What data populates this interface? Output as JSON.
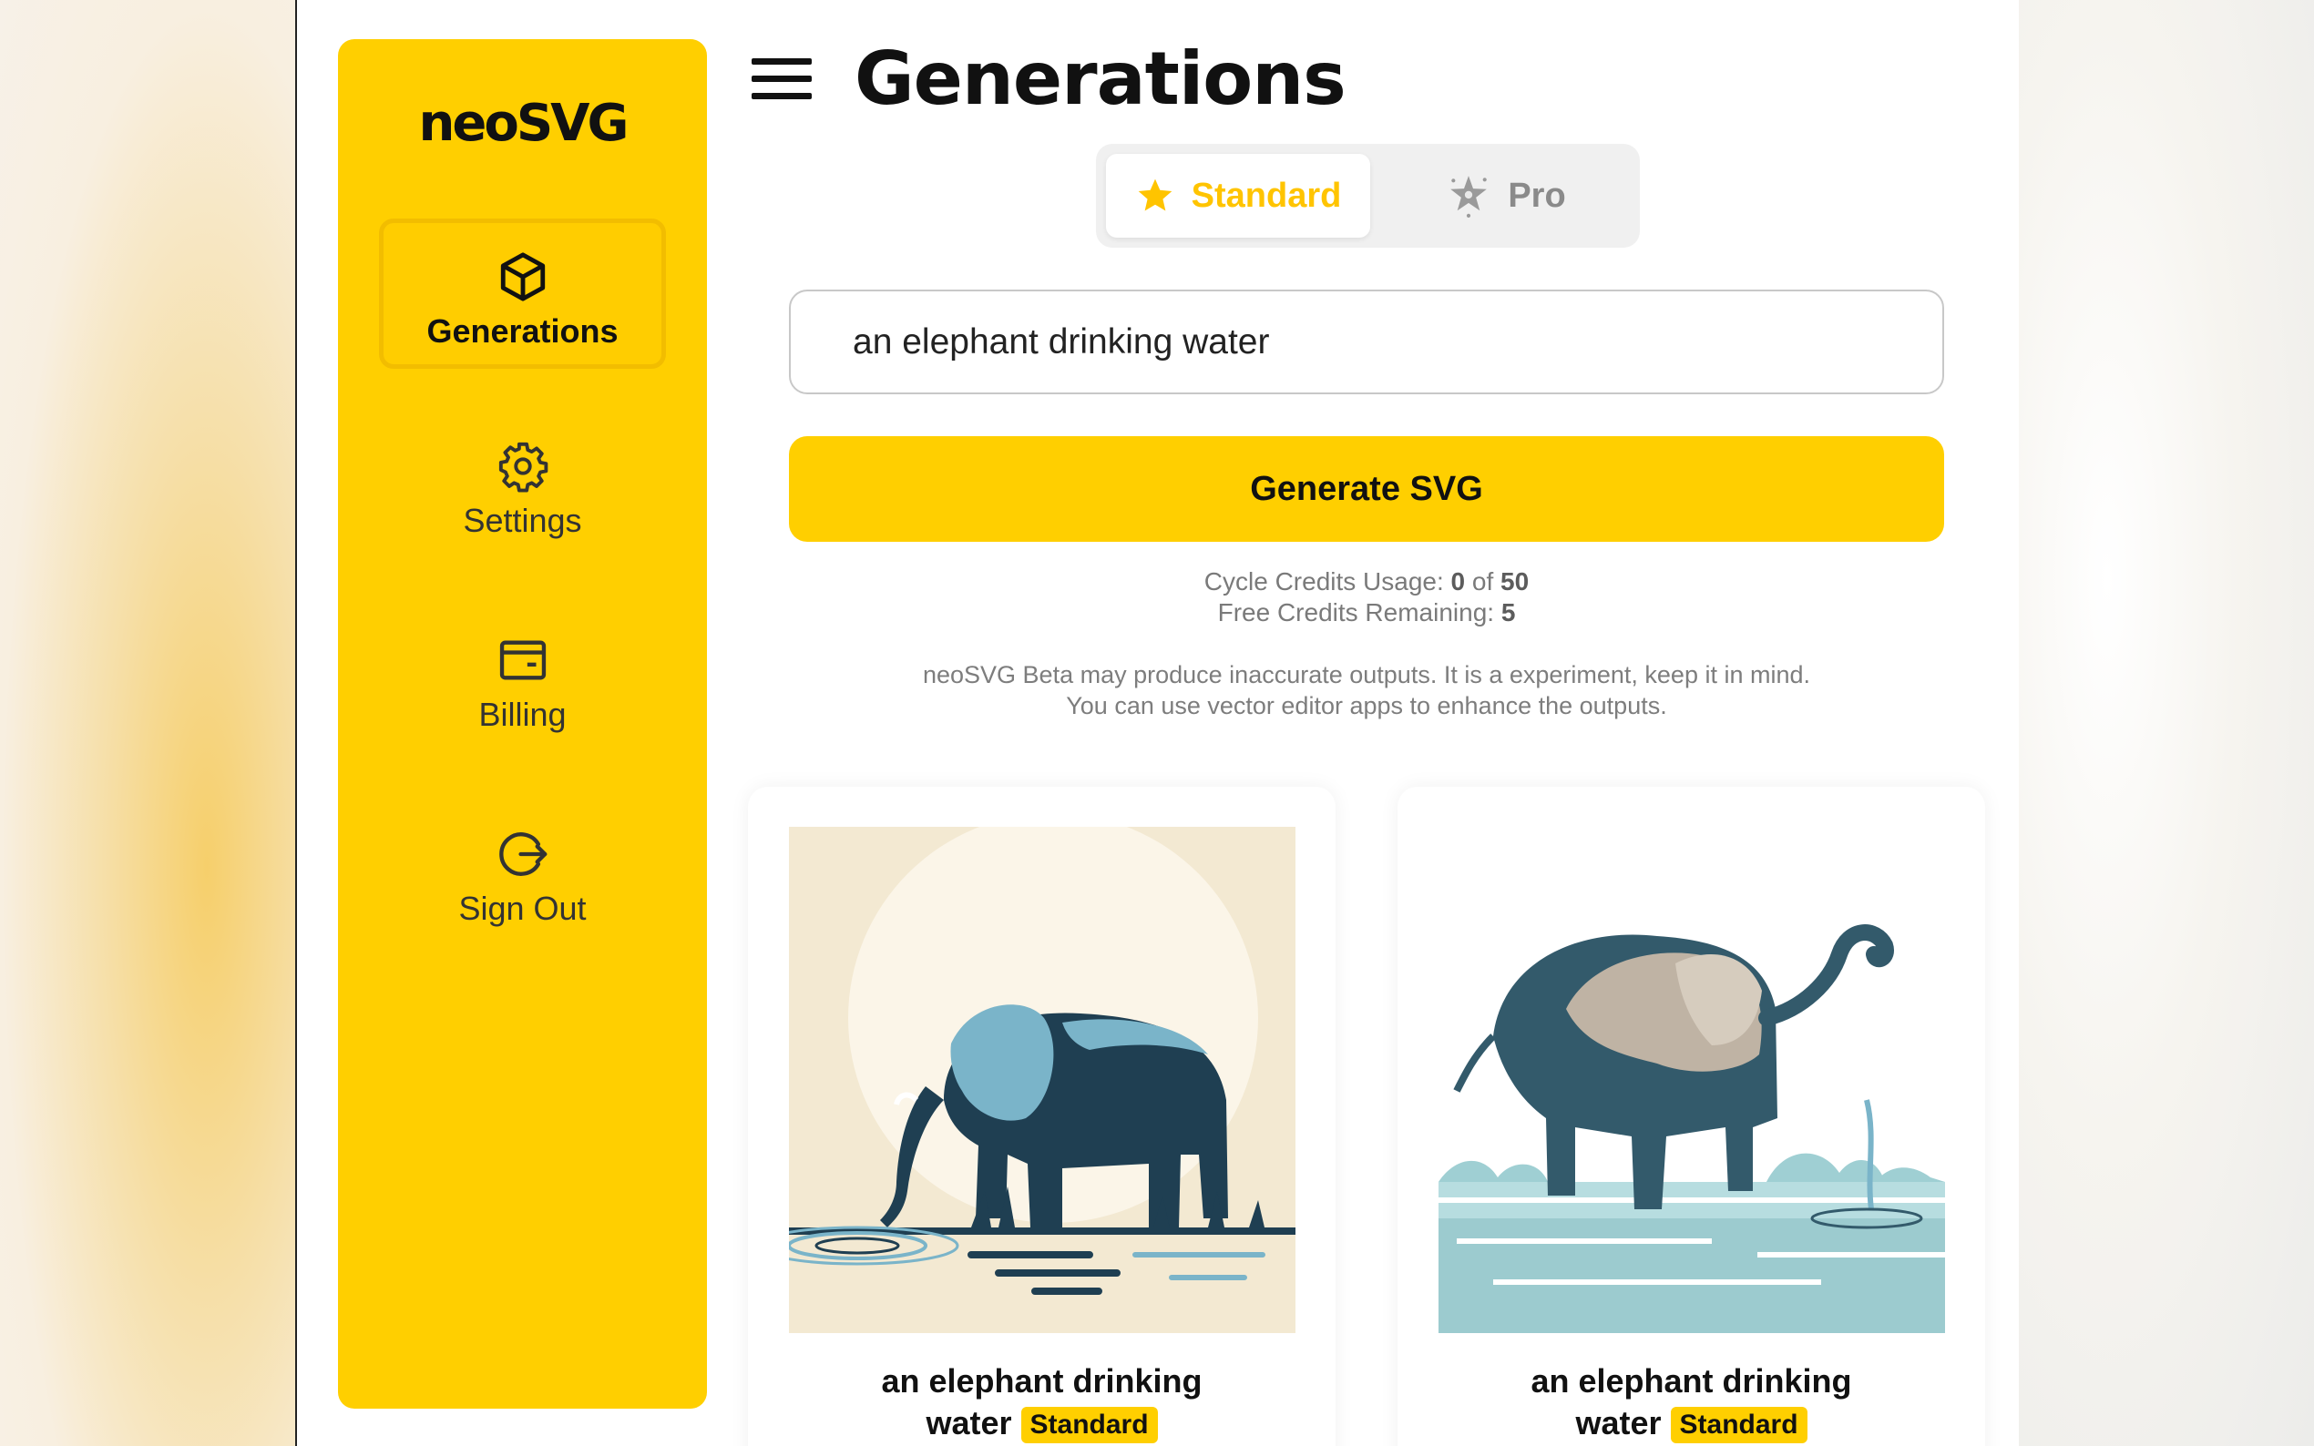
{
  "app": {
    "logo": "neoSVG",
    "page_title": "Generations"
  },
  "sidebar": {
    "items": [
      {
        "label": "Generations",
        "icon": "cube-icon",
        "active": true
      },
      {
        "label": "Settings",
        "icon": "gear-icon",
        "active": false
      },
      {
        "label": "Billing",
        "icon": "wallet-icon",
        "active": false
      },
      {
        "label": "Sign Out",
        "icon": "sign-out-icon",
        "active": false
      }
    ]
  },
  "mode_toggle": {
    "standard_label": "Standard",
    "pro_label": "Pro",
    "selected": "Standard"
  },
  "prompt": {
    "value": "an elephant drinking water"
  },
  "generate_button": {
    "label": "Generate SVG"
  },
  "credits": {
    "cycle_label": "Cycle Credits Usage:",
    "cycle_used": "0",
    "of_label": "of",
    "cycle_total": "50",
    "free_label": "Free Credits Remaining:",
    "free_remaining": "5"
  },
  "disclaimer": {
    "line1": "neoSVG Beta may produce inaccurate outputs. It is a experiment, keep it in mind.",
    "line2": "You can use vector editor apps to enhance the outputs."
  },
  "generations": [
    {
      "title_line1": "an elephant drinking",
      "title_line2": "water",
      "badge": "Standard"
    },
    {
      "title_line1": "an elephant drinking",
      "title_line2": "water",
      "badge": "Standard"
    }
  ],
  "colors": {
    "brand_yellow": "#ffcf00",
    "accent_text": "#ffc400",
    "text_dark": "#111111",
    "muted": "#7a7a7a"
  }
}
